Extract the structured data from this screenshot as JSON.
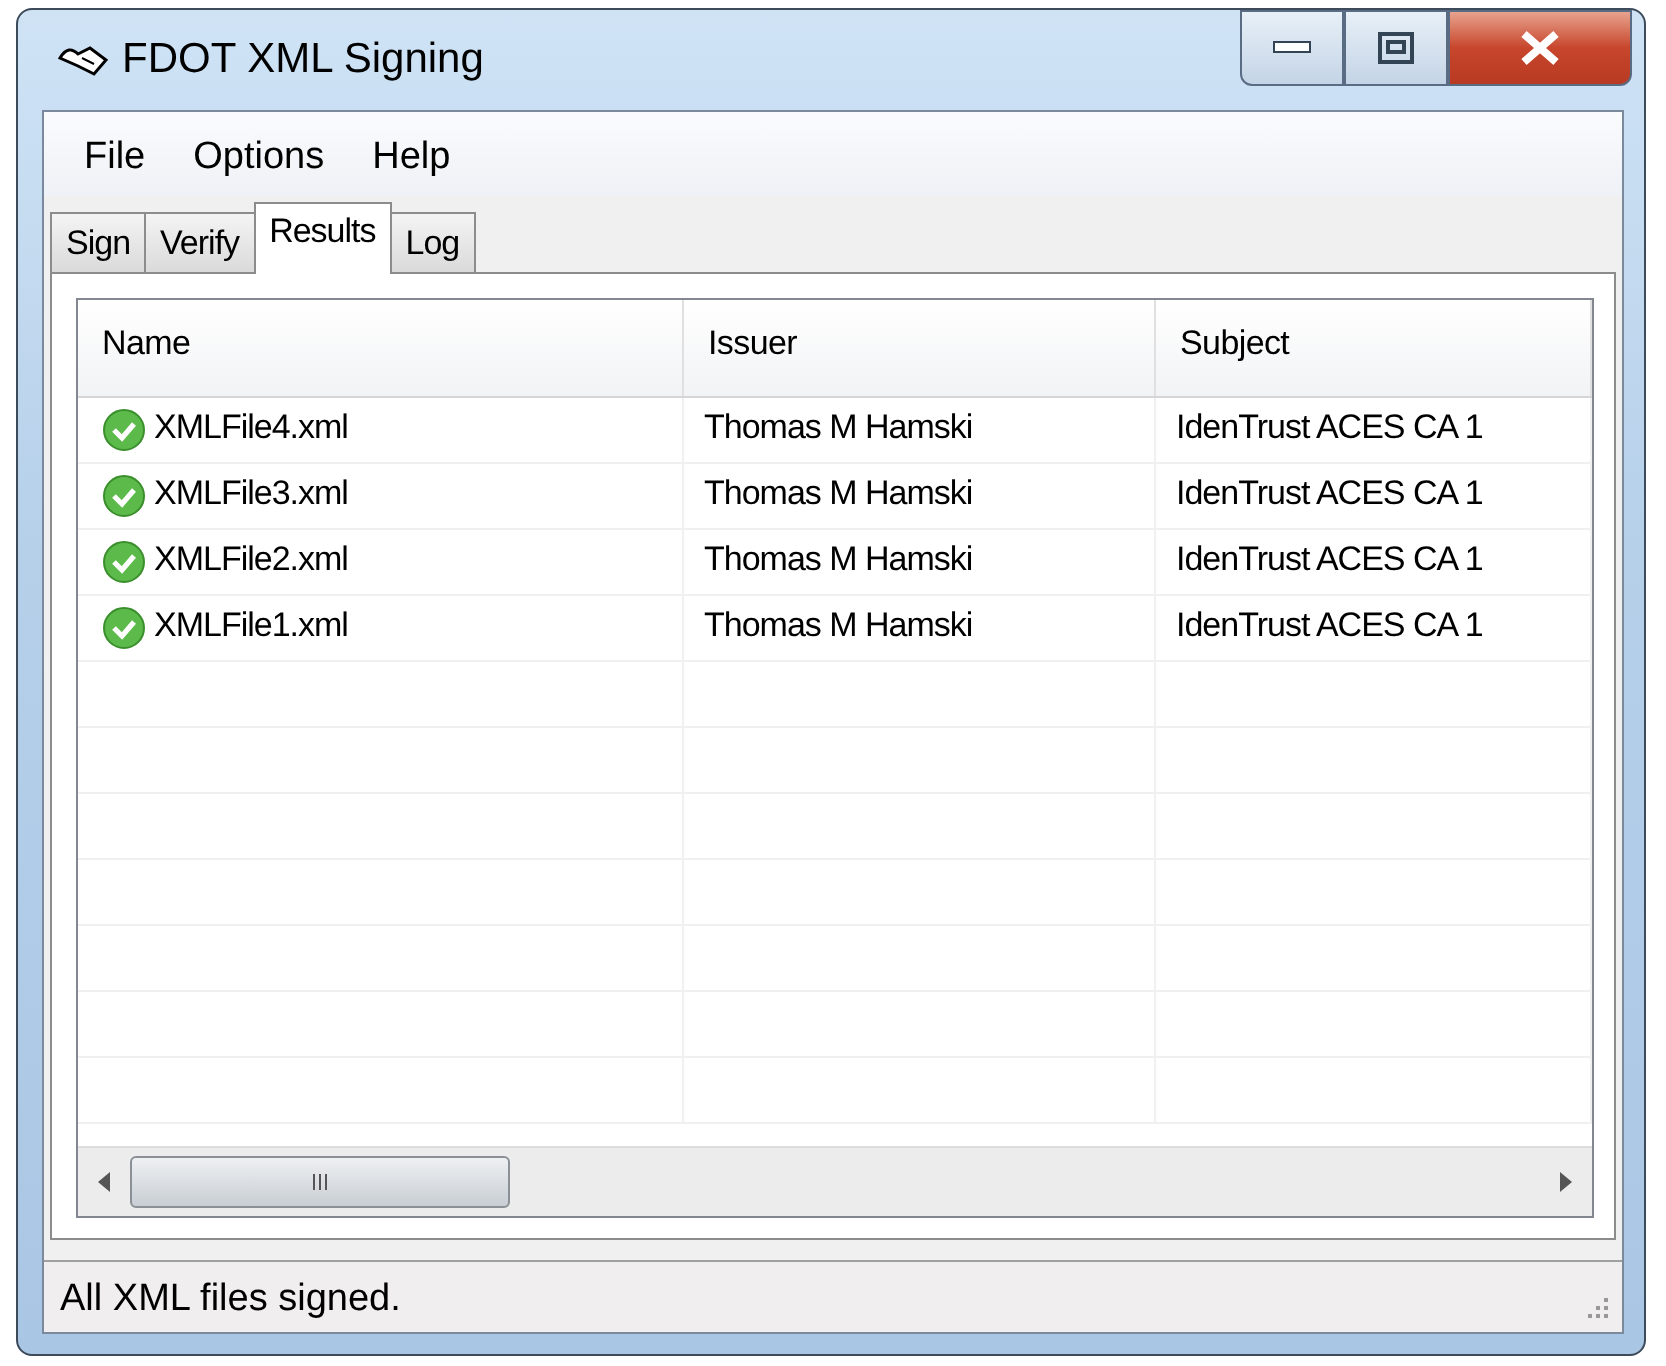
{
  "window": {
    "title": "FDOT XML Signing"
  },
  "menu": [
    "File",
    "Options",
    "Help"
  ],
  "tabs": [
    {
      "label": "Sign",
      "selected": false
    },
    {
      "label": "Verify",
      "selected": false
    },
    {
      "label": "Results",
      "selected": true
    },
    {
      "label": "Log",
      "selected": false
    }
  ],
  "table": {
    "columns": [
      "Name",
      "Issuer",
      "Subject"
    ],
    "rows": [
      {
        "name": "XMLFile4.xml",
        "issuer": "Thomas M Hamski",
        "subject": "IdenTrust ACES CA 1"
      },
      {
        "name": "XMLFile3.xml",
        "issuer": "Thomas M Hamski",
        "subject": "IdenTrust ACES CA 1"
      },
      {
        "name": "XMLFile2.xml",
        "issuer": "Thomas M Hamski",
        "subject": "IdenTrust ACES CA 1"
      },
      {
        "name": "XMLFile1.xml",
        "issuer": "Thomas M Hamski",
        "subject": "IdenTrust ACES CA 1"
      }
    ]
  },
  "status_bar": "All XML files signed."
}
